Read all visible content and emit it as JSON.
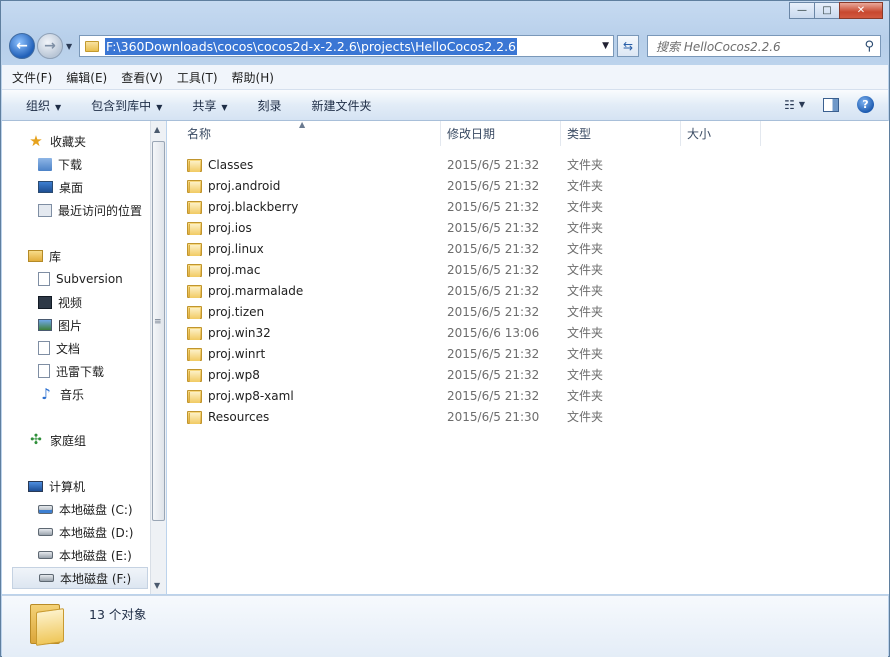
{
  "window": {
    "caption_buttons": {
      "minimize": "—",
      "maximize": "□",
      "close": "✕"
    }
  },
  "nav": {
    "address_path": "F:\\360Downloads\\cocos\\cocos2d-x-2.2.6\\projects\\HelloCocos2.2.6",
    "search_placeholder": "搜索 HelloCocos2.2.6"
  },
  "menubar": [
    "文件(F)",
    "编辑(E)",
    "查看(V)",
    "工具(T)",
    "帮助(H)"
  ],
  "commandbar": {
    "organize": "组织",
    "include_in_library": "包含到库中",
    "share": "共享",
    "burn": "刻录",
    "new_folder": "新建文件夹"
  },
  "sidebar": {
    "favorites": "收藏夹",
    "favorites_items": [
      "下载",
      "桌面",
      "最近访问的位置"
    ],
    "libraries": "库",
    "libraries_items": [
      "Subversion",
      "视频",
      "图片",
      "文档",
      "迅雷下载",
      "音乐"
    ],
    "homegroup": "家庭组",
    "computer": "计算机",
    "drives": [
      "本地磁盘 (C:)",
      "本地磁盘 (D:)",
      "本地磁盘 (E:)",
      "本地磁盘 (F:)"
    ]
  },
  "columns": {
    "name": "名称",
    "date": "修改日期",
    "type": "类型",
    "size": "大小"
  },
  "files": [
    {
      "name": "Classes",
      "date": "2015/6/5 21:32",
      "type": "文件夹"
    },
    {
      "name": "proj.android",
      "date": "2015/6/5 21:32",
      "type": "文件夹"
    },
    {
      "name": "proj.blackberry",
      "date": "2015/6/5 21:32",
      "type": "文件夹"
    },
    {
      "name": "proj.ios",
      "date": "2015/6/5 21:32",
      "type": "文件夹"
    },
    {
      "name": "proj.linux",
      "date": "2015/6/5 21:32",
      "type": "文件夹"
    },
    {
      "name": "proj.mac",
      "date": "2015/6/5 21:32",
      "type": "文件夹"
    },
    {
      "name": "proj.marmalade",
      "date": "2015/6/5 21:32",
      "type": "文件夹"
    },
    {
      "name": "proj.tizen",
      "date": "2015/6/5 21:32",
      "type": "文件夹"
    },
    {
      "name": "proj.win32",
      "date": "2015/6/6 13:06",
      "type": "文件夹"
    },
    {
      "name": "proj.winrt",
      "date": "2015/6/5 21:32",
      "type": "文件夹"
    },
    {
      "name": "proj.wp8",
      "date": "2015/6/5 21:32",
      "type": "文件夹"
    },
    {
      "name": "proj.wp8-xaml",
      "date": "2015/6/5 21:32",
      "type": "文件夹"
    },
    {
      "name": "Resources",
      "date": "2015/6/5 21:30",
      "type": "文件夹"
    }
  ],
  "status": {
    "count": "13 个对象"
  }
}
